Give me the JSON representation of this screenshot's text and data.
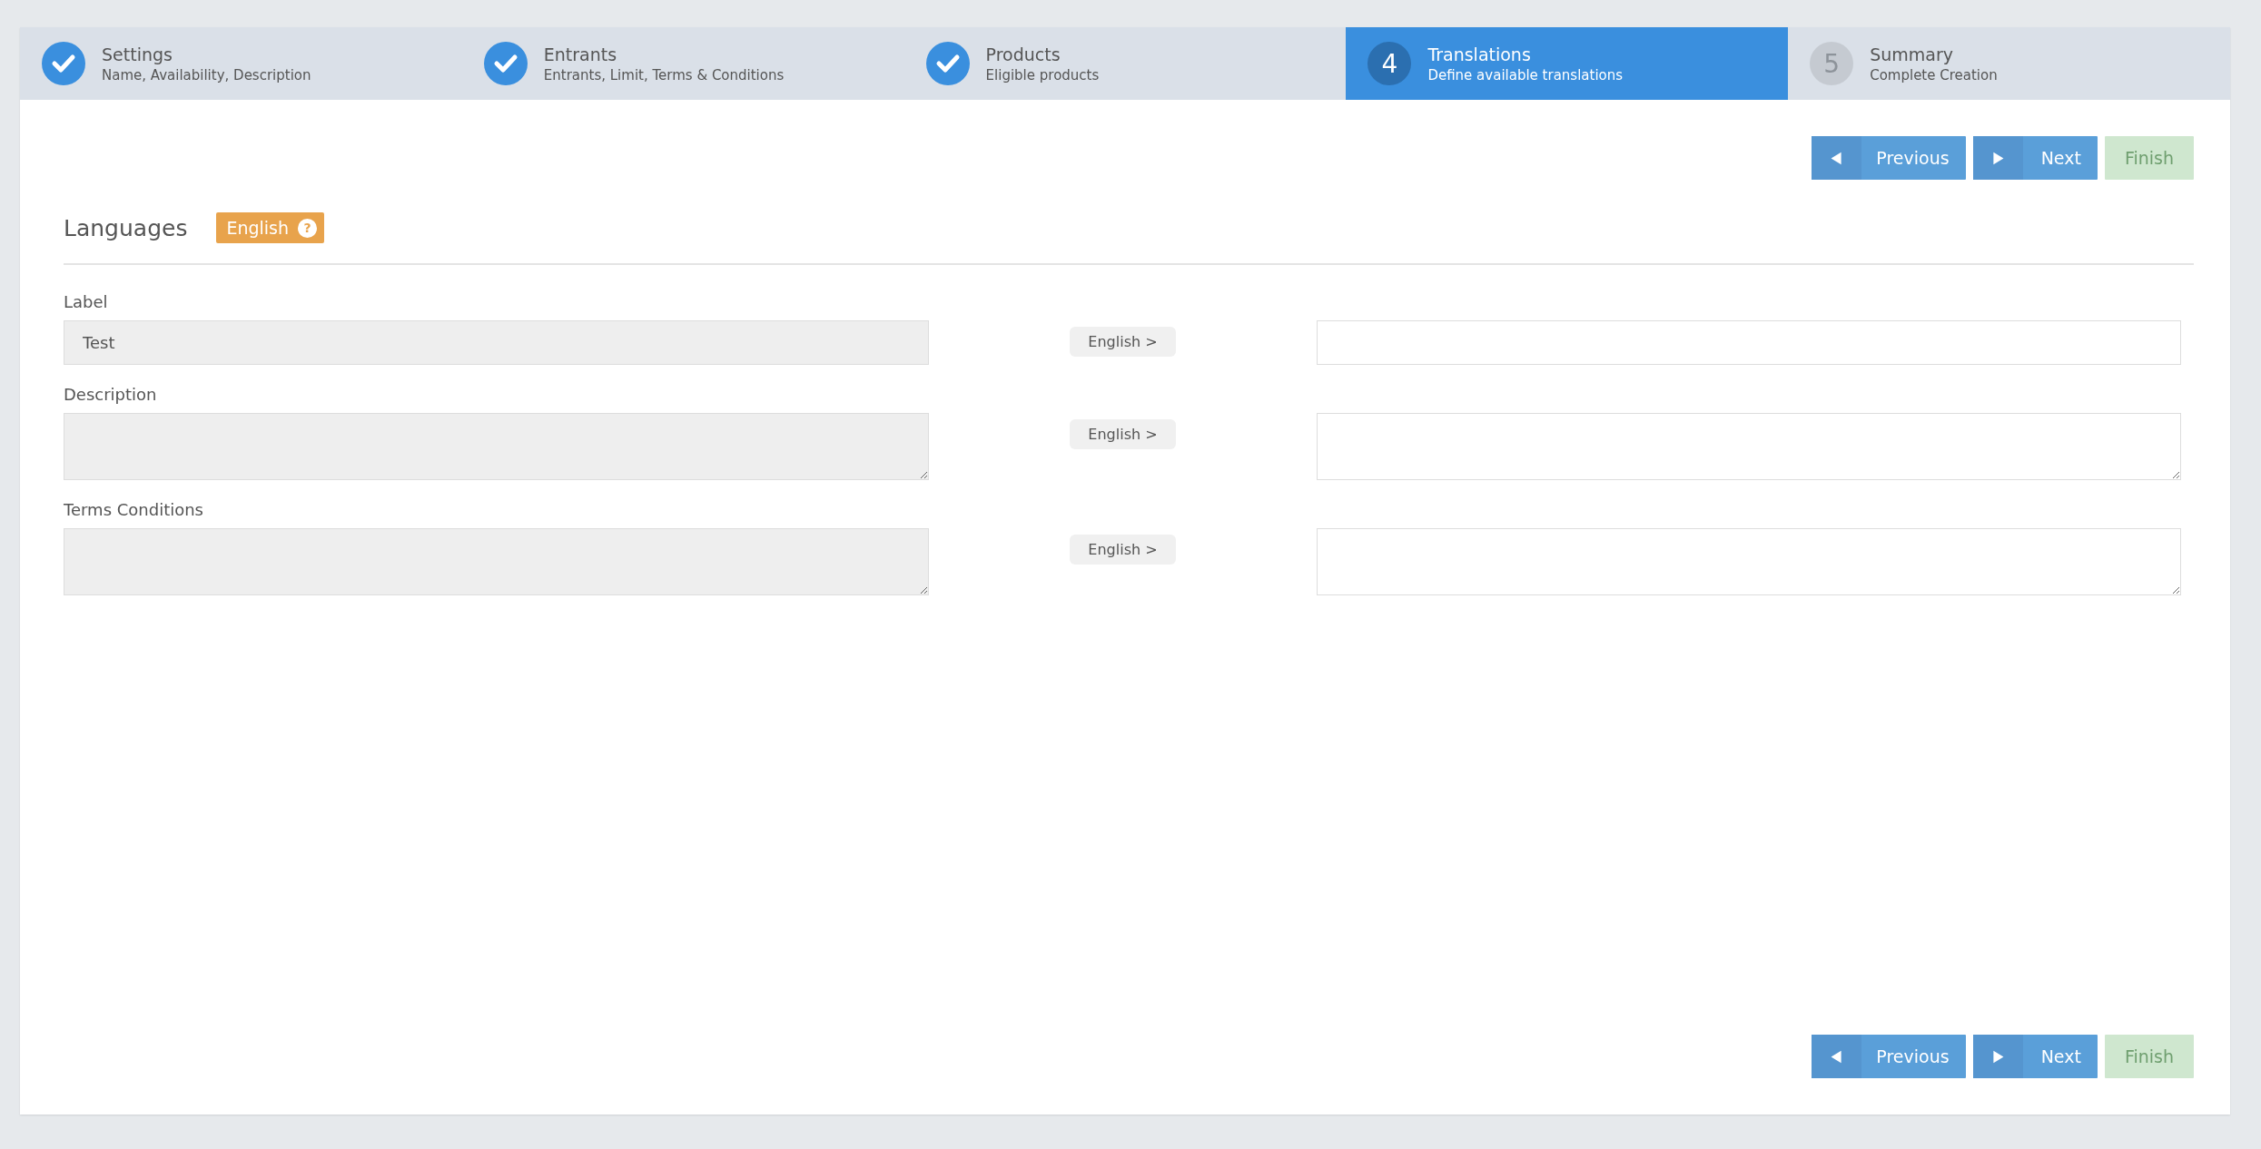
{
  "steps": [
    {
      "title": "Settings",
      "subtitle": "Name, Availability, Description",
      "completed": true,
      "selected": false
    },
    {
      "title": "Entrants",
      "subtitle": "Entrants, Limit, Terms & Conditions",
      "completed": true,
      "selected": false
    },
    {
      "title": "Products",
      "subtitle": "Eligible products",
      "completed": true,
      "selected": false
    },
    {
      "number": "4",
      "title": "Translations",
      "subtitle": "Define available translations",
      "completed": false,
      "selected": true
    },
    {
      "number": "5",
      "title": "Summary",
      "subtitle": "Complete Creation",
      "completed": false,
      "selected": false
    }
  ],
  "top_buttons": [
    {
      "kind": "previous",
      "label": "Previous",
      "disabled": false
    },
    {
      "kind": "next",
      "label": "Next",
      "disabled": false
    },
    {
      "kind": "finish",
      "label": "Finish",
      "disabled": true
    }
  ],
  "languages": {
    "title": "Languages",
    "badge": "English",
    "help_mark": "?"
  },
  "fields": [
    {
      "kind": "input",
      "label": "Label",
      "value": "Test",
      "source_button": "English >"
    },
    {
      "kind": "textarea",
      "label": "Description",
      "source_button": "English >"
    },
    {
      "kind": "textarea",
      "label": "Terms Conditions",
      "source_button": "English >"
    }
  ],
  "bottom_buttons": [
    {
      "kind": "previous",
      "label": "Previous",
      "disabled": false
    },
    {
      "kind": "next",
      "label": "Next",
      "disabled": false
    },
    {
      "kind": "finish",
      "label": "Finish",
      "disabled": true
    }
  ]
}
